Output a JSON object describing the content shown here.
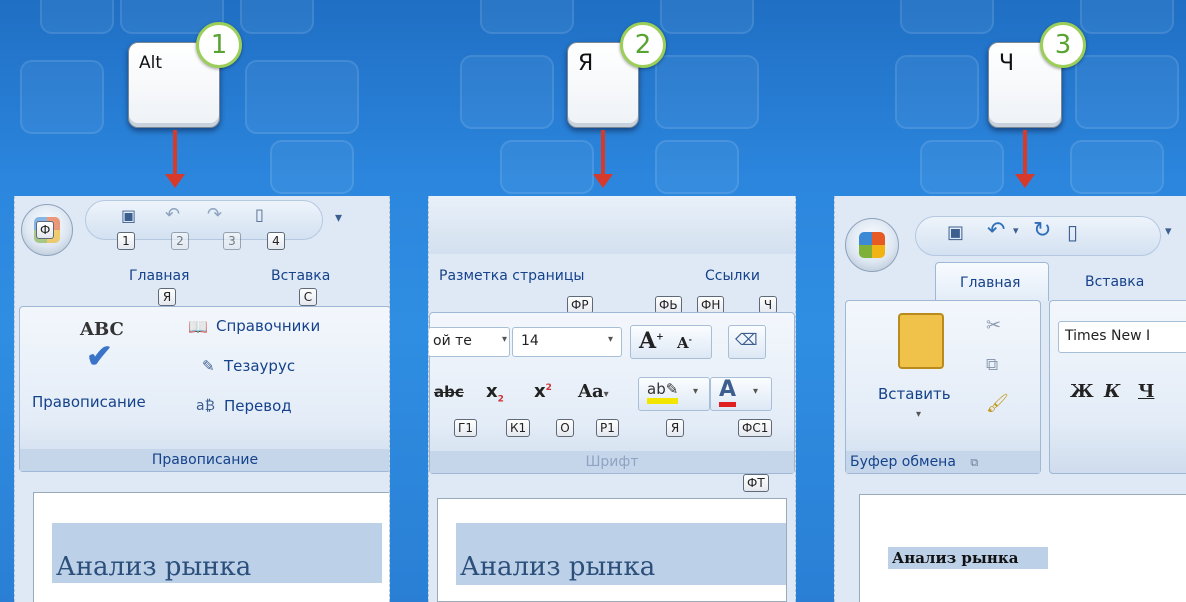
{
  "steps": [
    {
      "key": "Alt",
      "number": "1"
    },
    {
      "key": "Я",
      "number": "2"
    },
    {
      "key": "Ч",
      "number": "3"
    }
  ],
  "panel1": {
    "qat_tips": [
      "1",
      "2",
      "3",
      "4"
    ],
    "tabs": [
      {
        "label": "Главная",
        "tip": "Я"
      },
      {
        "label": "Вставка",
        "tip": "С"
      }
    ],
    "big_button": {
      "icon_text": "ABC",
      "label": "Правописание"
    },
    "items": [
      "Справочники",
      "Тезаурус",
      "Перевод"
    ],
    "group_title": "Правописание",
    "heading": "Анализ рынка"
  },
  "panel2": {
    "tabs": [
      {
        "label": "Разметка страницы"
      },
      {
        "label": "Ссылки"
      }
    ],
    "top_tips": [
      "ФР",
      "ФЬ",
      "ФН",
      "Ч"
    ],
    "font_name": "ой те",
    "font_size": "14",
    "row2_tips": [
      "Г1",
      "К1",
      "О",
      "Р1",
      "Я",
      "ФС1"
    ],
    "extra_tip": "ФТ",
    "group_title": "Шрифт",
    "heading": "Анализ рынка"
  },
  "panel3": {
    "tabs": [
      {
        "label": "Главная"
      },
      {
        "label": "Вставка"
      }
    ],
    "paste_label": "Вставить",
    "clipboard_title": "Буфер обмена",
    "font_name": "Times New I",
    "format_buttons": [
      "Ж",
      "К",
      "Ч"
    ],
    "heading": "Анализ рынка"
  }
}
